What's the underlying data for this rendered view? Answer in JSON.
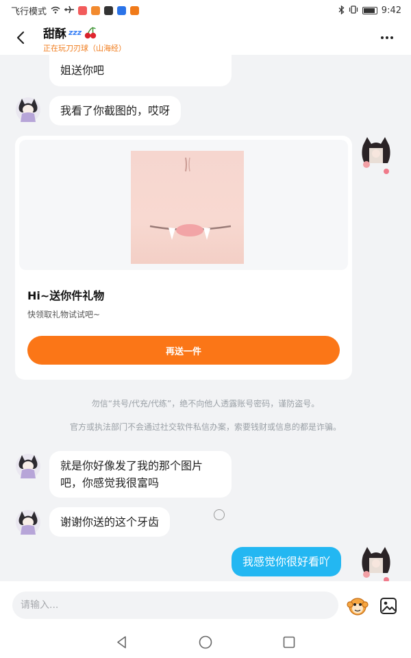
{
  "status_bar": {
    "left_text": "飞行模式",
    "time": "9:42",
    "battery_level": 0.9,
    "app_icon_colors": [
      "#f25b5b",
      "#f28a2e",
      "#333333",
      "#2a73e8",
      "#f07a19"
    ]
  },
  "header": {
    "title": "甜酥",
    "title_badge": "zzz",
    "status_text": "正在玩刀刃球（山海经）"
  },
  "messages": [
    {
      "side": "left",
      "text": "姐送你吧"
    },
    {
      "side": "left",
      "text": "我看了你截图的，哎呀"
    },
    {
      "side": "left",
      "text": "就是你好像发了我的那个图片吧，你感觉我很富吗"
    },
    {
      "side": "left",
      "text": "谢谢你送的这个牙齿"
    },
    {
      "side": "right",
      "text": "我感觉你很好看吖"
    }
  ],
  "gift_card": {
    "title": "Hi~送你件礼物",
    "subtitle": "快领取礼物试试吧~",
    "button_label": "再送一件"
  },
  "notices": [
    "勿信“共号/代充/代练”，绝不向他人透露账号密码，谨防盗号。",
    "官方或执法部门不会通过社交软件私信办案，索要钱财或信息的都是诈骗。"
  ],
  "input": {
    "placeholder": "请输入..."
  },
  "icons": {
    "back": "chevron-left-icon",
    "more": "more-dots-icon",
    "emoji": "monkey-face-icon",
    "image": "image-icon",
    "nav_back": "triangle-back-icon",
    "nav_home": "circle-home-icon",
    "nav_recent": "square-recent-icon"
  },
  "colors": {
    "accent_orange": "#fb7617",
    "status_orange": "#f07a19",
    "self_bubble": "#23b7f2",
    "background": "#f2f3f5"
  }
}
